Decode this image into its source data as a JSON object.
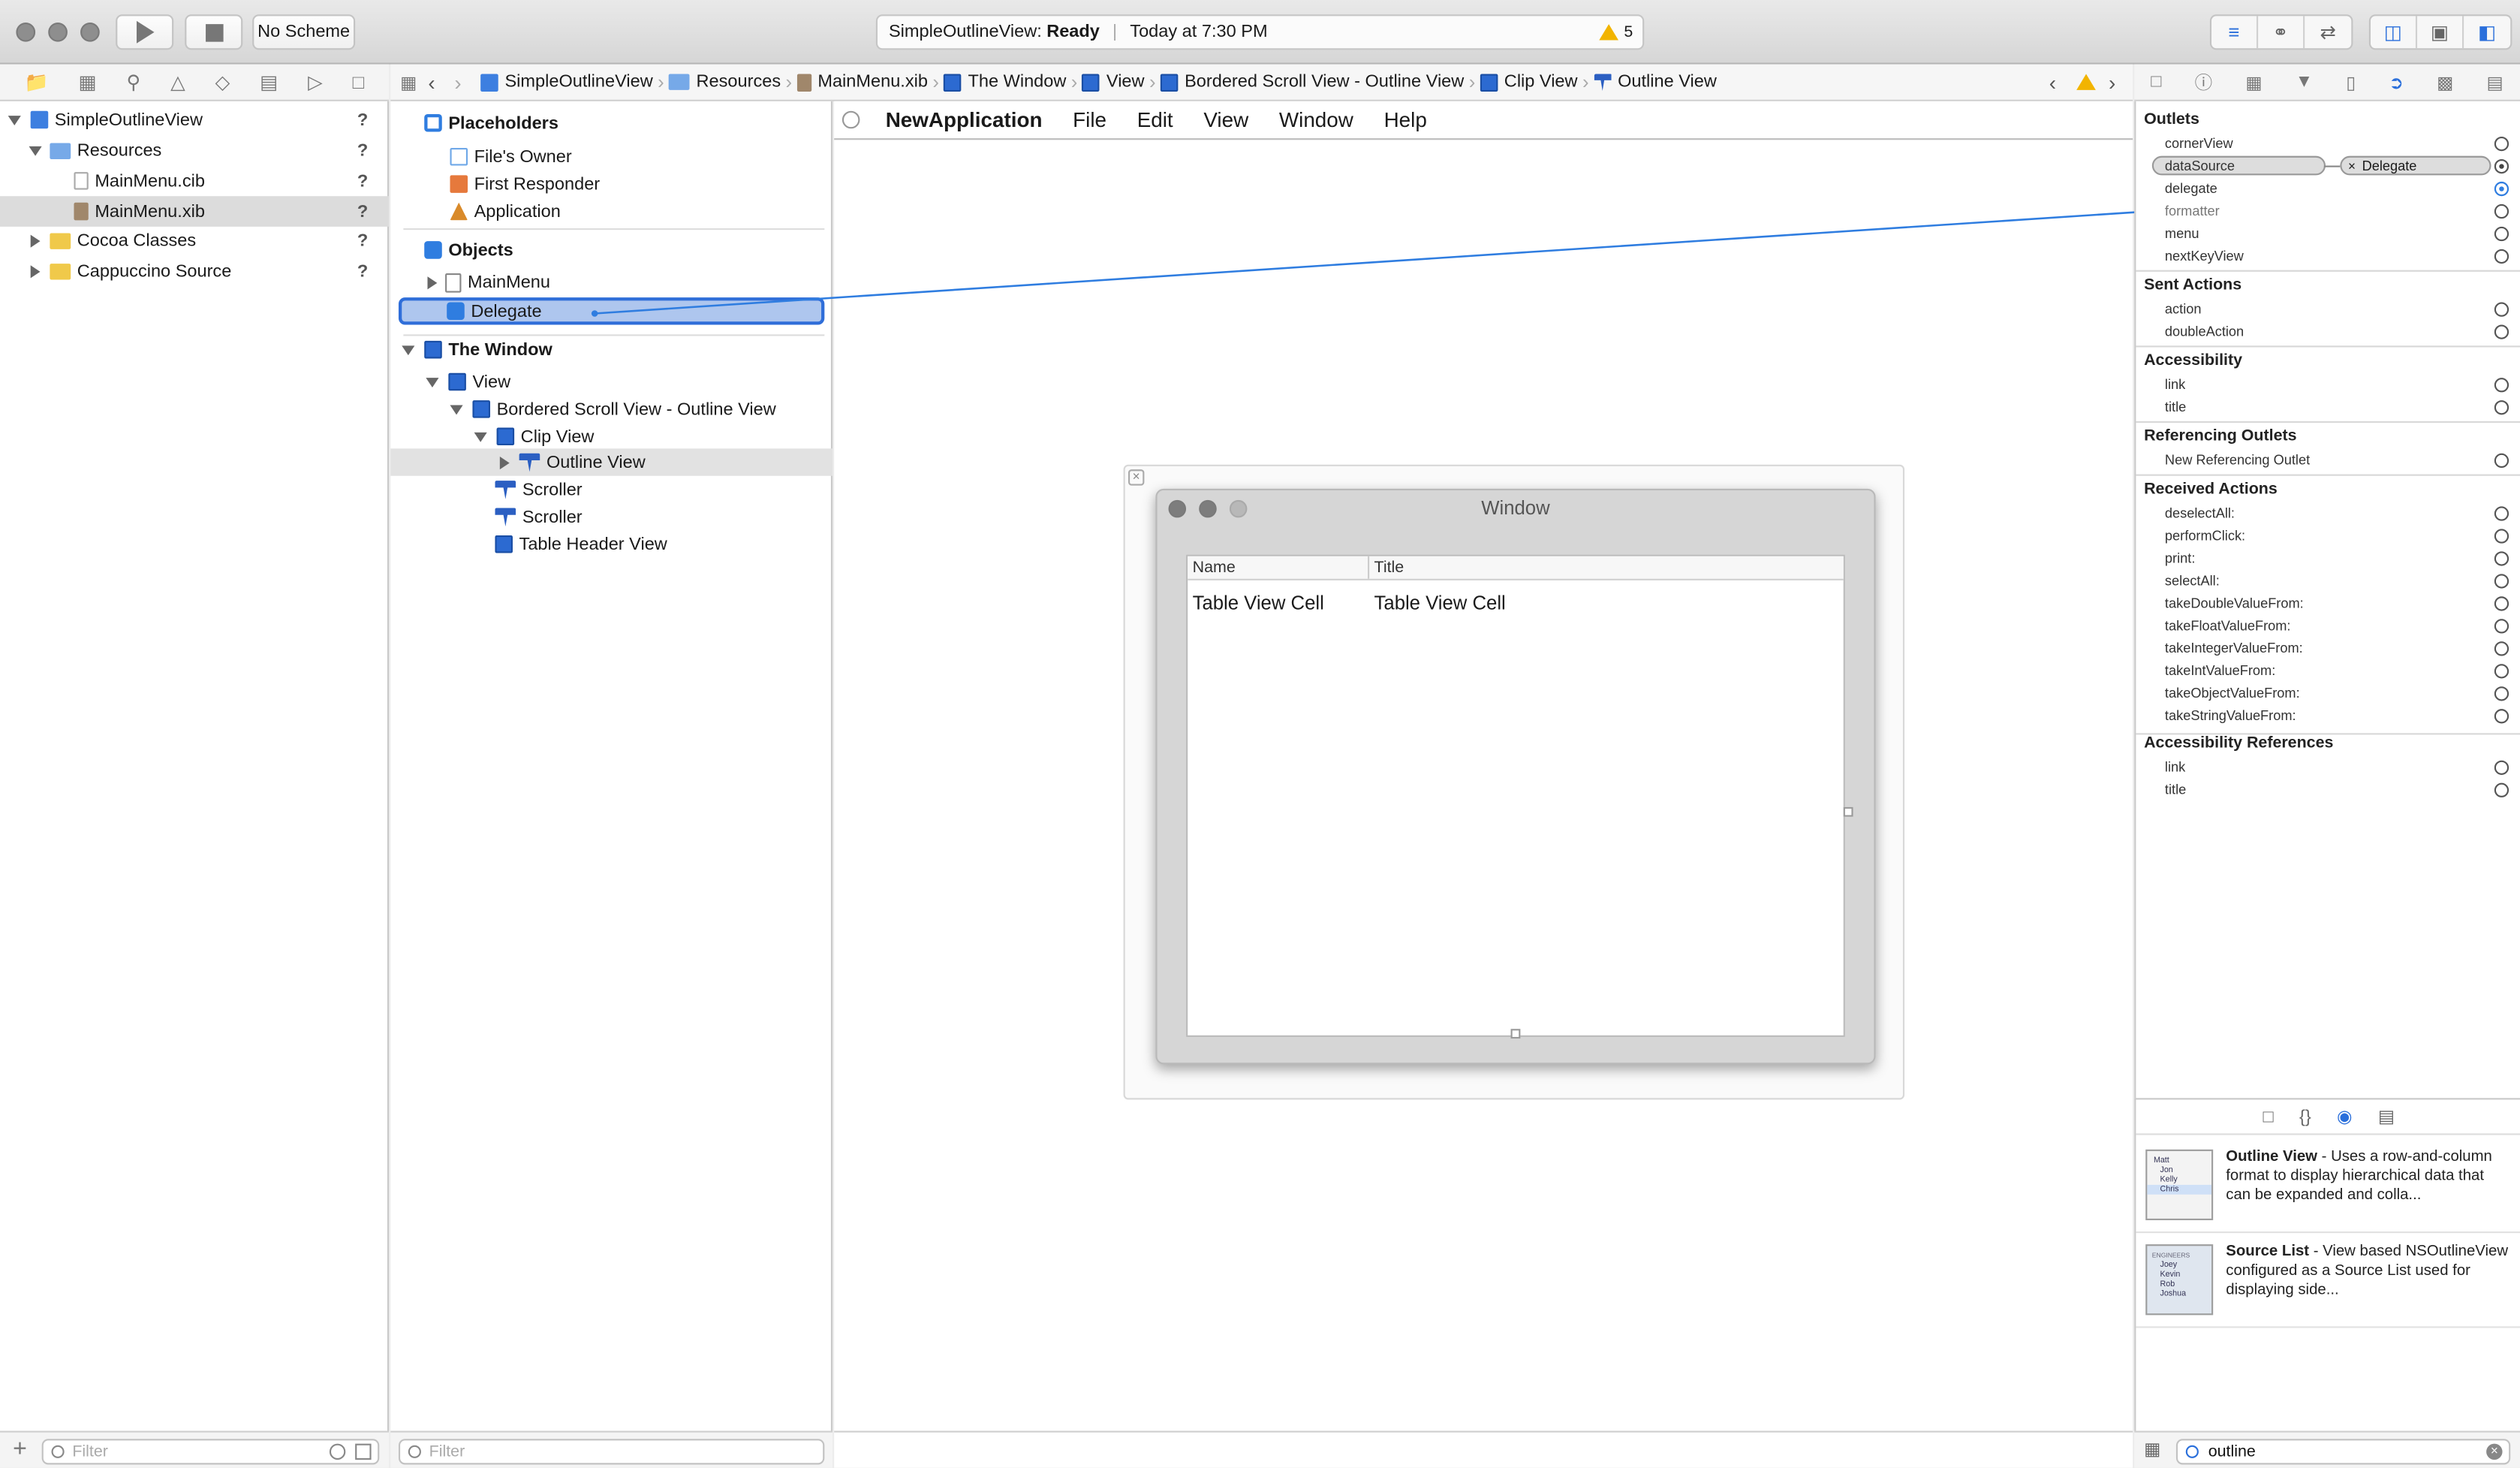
{
  "toolbar": {
    "scheme": "No Scheme",
    "activity_project": "SimpleOutlineView:",
    "activity_status": "Ready",
    "activity_time": "Today at 7:30 PM",
    "warning_count": "5"
  },
  "jumpbar": {
    "crumbs": [
      "SimpleOutlineView",
      "Resources",
      "MainMenu.xib",
      "The Window",
      "View",
      "Bordered Scroll View - Outline View",
      "Clip View",
      "Outline View"
    ]
  },
  "navigator": {
    "items": [
      {
        "label": "SimpleOutlineView",
        "status": "?"
      },
      {
        "label": "Resources",
        "status": "?"
      },
      {
        "label": "MainMenu.cib",
        "status": "?"
      },
      {
        "label": "MainMenu.xib",
        "status": "?"
      },
      {
        "label": "Cocoa Classes",
        "status": "?"
      },
      {
        "label": "Cappuccino Source",
        "status": "?"
      }
    ],
    "filter_placeholder": "Filter"
  },
  "outline": {
    "placeholders_heading": "Placeholders",
    "placeholders": [
      "File's Owner",
      "First Responder",
      "Application"
    ],
    "objects_heading": "Objects",
    "objects": [
      "MainMenu",
      "Delegate"
    ],
    "window_heading": "The Window",
    "window_tree": [
      "View",
      "Bordered Scroll View - Outline View",
      "Clip View",
      "Outline View",
      "Scroller",
      "Scroller",
      "Table Header View"
    ],
    "filter_placeholder": "Filter"
  },
  "canvas": {
    "menu": [
      "NewApplication",
      "File",
      "Edit",
      "View",
      "Window",
      "Help"
    ],
    "window_title": "Window",
    "columns": [
      "Name",
      "Title"
    ],
    "cells": [
      "Table View Cell",
      "Table View Cell"
    ]
  },
  "inspector": {
    "outlets_heading": "Outlets",
    "outlets": [
      "cornerView",
      "dataSource",
      "delegate",
      "formatter",
      "menu",
      "nextKeyView"
    ],
    "datasource_target": "Delegate",
    "sent_heading": "Sent Actions",
    "sent": [
      "action",
      "doubleAction"
    ],
    "access_heading": "Accessibility",
    "access": [
      "link",
      "title"
    ],
    "ref_heading": "Referencing Outlets",
    "ref": [
      "New Referencing Outlet"
    ],
    "recv_heading": "Received Actions",
    "recv": [
      "deselectAll:",
      "performClick:",
      "print:",
      "selectAll:",
      "takeDoubleValueFrom:",
      "takeFloatValueFrom:",
      "takeIntegerValueFrom:",
      "takeIntValueFrom:",
      "takeObjectValueFrom:",
      "takeStringValueFrom:"
    ],
    "accref_heading": "Accessibility References",
    "accref": [
      "link",
      "title"
    ]
  },
  "library": {
    "items": [
      {
        "title": "Outline View",
        "desc": " - Uses a row-and-column format to display hierarchical data that can be expanded and colla...",
        "thumb": [
          "Matt",
          "Jon",
          "Kelly",
          "Chris"
        ]
      },
      {
        "title": "Source List",
        "desc": " - View based NSOutlineView configured as a Source List used for displaying side...",
        "thumb": [
          "ENGINEERS",
          "Joey",
          "Kevin",
          "Rob",
          "Joshua"
        ]
      }
    ],
    "search_value": "outline"
  },
  "colors": {
    "accent": "#2a6fdb",
    "selection": "#aec6ee",
    "connection": "#2f7de0",
    "warning": "#f2b400"
  }
}
